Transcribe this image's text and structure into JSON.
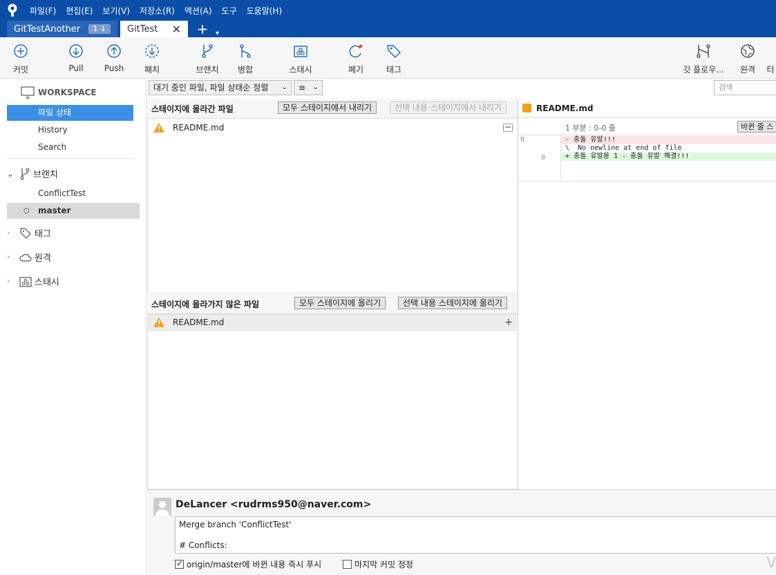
{
  "menu": [
    "파일(F)",
    "편집(E)",
    "보기(V)",
    "저장소(R)",
    "액션(A)",
    "도구",
    "도움말(H)"
  ],
  "tabs": {
    "inactive": {
      "label": "GitTestAnother",
      "badge": "1 ↓"
    },
    "active": {
      "label": "GitTest",
      "close": "✕"
    },
    "add": "+",
    "dropdown": "▾"
  },
  "toolbar": {
    "commit": "커밋",
    "pull": "Pull",
    "push": "Push",
    "fetch": "패치",
    "branch": "브랜치",
    "merge": "병합",
    "stash": "스태시",
    "discard": "폐기",
    "tag": "태그",
    "gitflow": "깃 플로우...",
    "remote": "원격",
    "terminal": "터"
  },
  "sidebar": {
    "workspace": "WORKSPACE",
    "file_status": "파일 상태",
    "history": "History",
    "search": "Search",
    "branches": "브랜치",
    "branch_items": [
      "ConflictTest",
      "master"
    ],
    "tags": "태그",
    "remotes": "원격",
    "stashes": "스태시"
  },
  "controls": {
    "sort": "대기 중인 파일, 파일 상태순 정렬",
    "view": "≡",
    "search_placeholder": "검색"
  },
  "staged": {
    "title": "스테이지에 올라간 파일",
    "unstage_all": "모두 스테이지에서 내리기",
    "unstage_selected": "선택 내용 스테이지에서 내리기",
    "files": [
      "README.md"
    ],
    "action": "−"
  },
  "unstaged": {
    "title": "스테이지에 올라가지 않은 파일",
    "stage_all": "모두 스테이지에 올리기",
    "stage_selected": "선택 내용 스테이지에 올리기",
    "files": [
      "README.md"
    ],
    "action": "+"
  },
  "diff": {
    "file": "README.md",
    "hunk": "1 부분 : 0-0 줄",
    "hunk_btn": "바뀐 줄 스",
    "old_line": "0",
    "new_line": "0",
    "lines": [
      "- 충돌 유발!!!",
      "\\  No newline at end of file",
      "+ 충돌 유발용 1 - 충돌 유발 해결!!!"
    ]
  },
  "commit": {
    "author": "DeLancer <rudrms950@naver.com>",
    "message": "Merge branch 'ConflictTest'\n\n# Conflicts:",
    "push_option": "origin/master에 바뀐 내용 즉시 푸시",
    "amend_option": "마지막 커밋 정정"
  },
  "watermark": "V"
}
